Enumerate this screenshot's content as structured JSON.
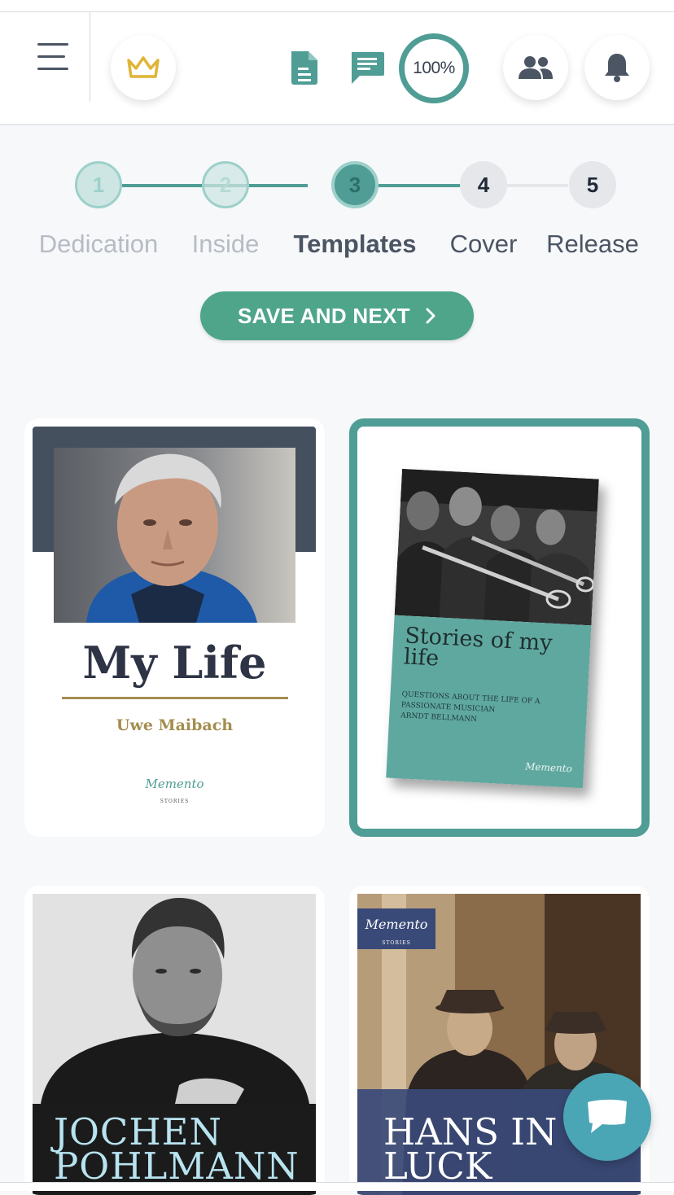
{
  "header": {
    "progress_label": "100%",
    "icons": [
      "menu-icon",
      "crown-icon",
      "document-icon",
      "chat-icon",
      "users-icon",
      "bell-icon"
    ]
  },
  "steps": [
    {
      "number": "1",
      "label": "Dedication",
      "state": "done"
    },
    {
      "number": "2",
      "label": "Inside",
      "state": "done"
    },
    {
      "number": "3",
      "label": "Templates",
      "state": "active"
    },
    {
      "number": "4",
      "label": "Cover",
      "state": "pending"
    },
    {
      "number": "5",
      "label": "Release",
      "state": "pending"
    }
  ],
  "save_button": {
    "label": "SAVE AND NEXT"
  },
  "templates": [
    {
      "title": "My Life",
      "author": "Uwe Maibach",
      "logo": "Memento STORIES",
      "selected": false
    },
    {
      "title": "Stories of my life",
      "subtitle_line1": "QUESTIONS ABOUT THE LIFE OF A",
      "subtitle_line2": "PASSIONATE MUSICIAN",
      "author": "ARNDT BELLMANN",
      "logo": "Memento STORIES",
      "selected": true
    },
    {
      "title_line1": "JOCHEN",
      "title_line2": "POHLMANN",
      "selected": false
    },
    {
      "title_line1": "HANS IN",
      "title_line2": "LUCK",
      "logo": "Memento STORIES",
      "selected": false
    }
  ],
  "colors": {
    "accent": "#4f9d95",
    "button": "#4ea58a",
    "crown": "#e0b435",
    "dark_band": "#45505f",
    "teal_cover": "#5fa8a0",
    "navy_band": "#3a4a78",
    "chat_fab": "#4aa5b5"
  }
}
